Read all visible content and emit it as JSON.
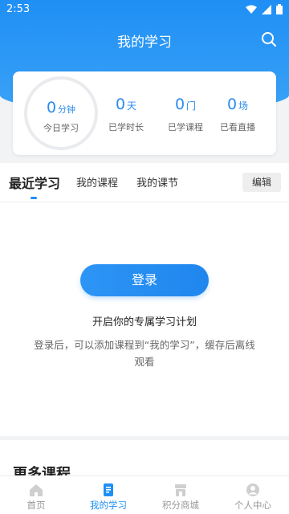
{
  "status_bar": {
    "time": "2:53"
  },
  "header": {
    "title": "我的学习"
  },
  "stats": {
    "today": {
      "value": "0",
      "unit": "分钟",
      "label": "今日学习"
    },
    "items": [
      {
        "value": "0",
        "unit": "天",
        "label": "已学时长"
      },
      {
        "value": "0",
        "unit": "门",
        "label": "已学课程"
      },
      {
        "value": "0",
        "unit": "场",
        "label": "已看直播"
      }
    ]
  },
  "tabs": [
    {
      "label": "最近学习"
    },
    {
      "label": "我的课程"
    },
    {
      "label": "我的课节"
    }
  ],
  "edit_label": "编辑",
  "login": {
    "button": "登录",
    "title": "开启你的专属学习计划",
    "desc": "登录后，可以添加课程到“我的学习”，缓存后离线观看"
  },
  "more_courses_title": "更多课程",
  "bottom_nav": [
    {
      "label": "首页",
      "icon": "home-icon"
    },
    {
      "label": "我的学习",
      "icon": "book-icon"
    },
    {
      "label": "积分商城",
      "icon": "store-icon"
    },
    {
      "label": "个人中心",
      "icon": "user-icon"
    }
  ],
  "colors": {
    "primary": "#1f8ff5",
    "text": "#222222",
    "muted": "#999999"
  }
}
